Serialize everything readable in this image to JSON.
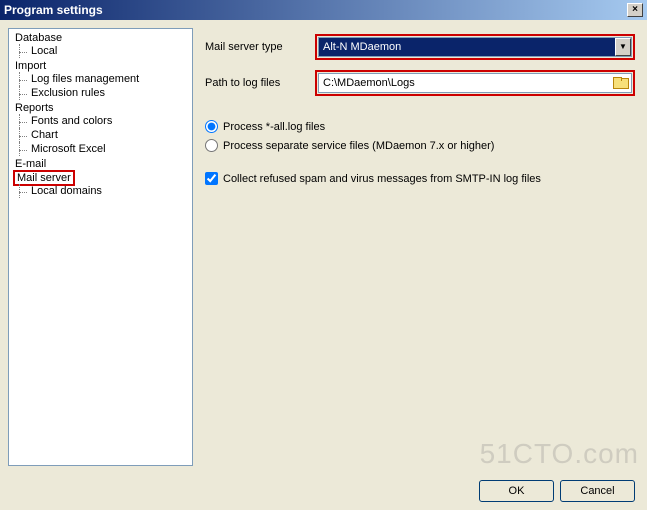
{
  "title": "Program settings",
  "tree": {
    "database": "Database",
    "database_local": "Local",
    "import": "Import",
    "import_logmgmt": "Log files management",
    "import_exclusion": "Exclusion rules",
    "reports": "Reports",
    "reports_fonts": "Fonts and colors",
    "reports_chart": "Chart",
    "reports_excel": "Microsoft Excel",
    "email": "E-mail",
    "mailserver": "Mail server",
    "mailserver_localdomains": "Local domains"
  },
  "form": {
    "server_type_label": "Mail server type",
    "server_type_value": "Alt-N MDaemon",
    "path_label": "Path to log files",
    "path_value": "C:\\MDaemon\\Logs"
  },
  "radios": {
    "all": "Process *-all.log files",
    "separate": "Process separate service files (MDaemon 7.x or higher)"
  },
  "checkbox": {
    "collect": "Collect refused spam and virus messages from SMTP-IN log files"
  },
  "buttons": {
    "ok": "OK",
    "cancel": "Cancel"
  },
  "watermark": "51CTO.com"
}
